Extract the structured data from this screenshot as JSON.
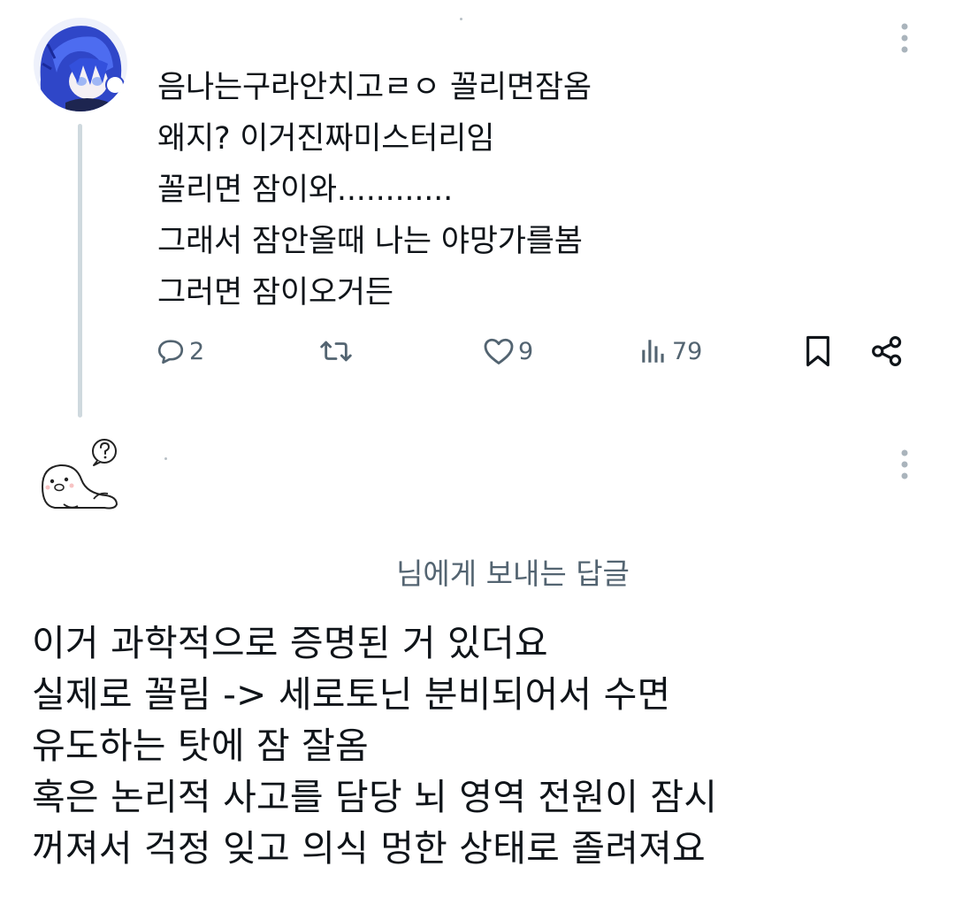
{
  "tweet": {
    "lines": [
      "음나는구라안치고ㄹㅇ 꼴리면잠옴",
      "왜지? 이거진짜미스터리임",
      "꼴리면 잠이와............",
      "그래서 잠안올때 나는 야망가를봄",
      "그러면 잠이오거든"
    ],
    "actions": {
      "reply_count": "2",
      "like_count": "9",
      "view_count": "79"
    }
  },
  "reply": {
    "replying_to": "님에게 보내는 답글",
    "lines": [
      "이거 과학적으로 증명된 거 있더요",
      "실제로 꼴림 -> 세로토닌 분비되어서 수면",
      "유도하는 탓에 잠 잘옴",
      "혹은 논리적 사고를 담당 뇌 영역 전원이 잠시",
      "꺼져서 걱정 잊고 의식 멍한 상태로 졸려져요"
    ]
  },
  "icons": {
    "reply": "speech-bubble-icon",
    "retweet": "retweet-icon",
    "like": "heart-icon",
    "views": "bar-chart-icon",
    "bookmark": "bookmark-icon",
    "share": "share-icon",
    "more": "vertical-dots-icon",
    "question": "question-bubble-icon"
  },
  "colors": {
    "text": "#0f1419",
    "secondary": "#536471",
    "thread_line": "#cfd9de",
    "avatar_blue": "#3b5bd6"
  }
}
